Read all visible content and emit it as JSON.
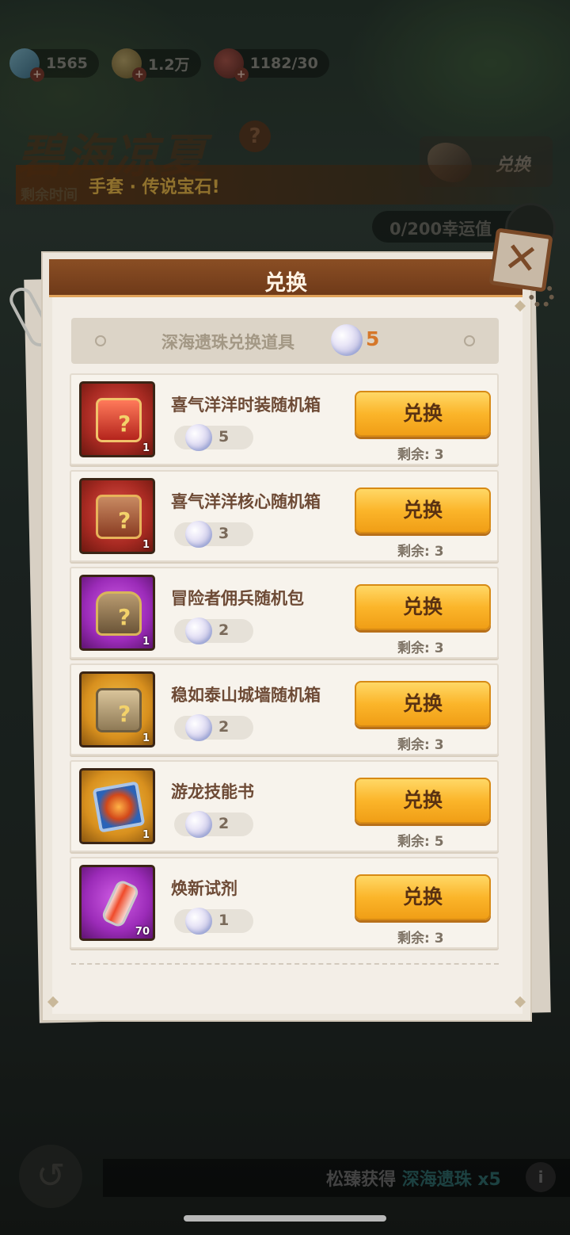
{
  "resources": [
    {
      "icon": "gem-icon",
      "value": "1565"
    },
    {
      "icon": "coin-icon",
      "value": "1.2万"
    },
    {
      "icon": "meat-icon",
      "value": "1182/30"
    }
  ],
  "event": {
    "title": "碧海凉夏",
    "time_label": "剩余时间",
    "banner": "手套 · 传说宝石!",
    "top_exchange_label": "兑换",
    "luck": "0/200幸运值"
  },
  "modal": {
    "title": "兑换",
    "close_symbol": "✕",
    "currency_label": "深海遗珠兑换道具",
    "currency_amount": "5",
    "button_label": "兑换",
    "items": [
      {
        "name": "喜气洋洋时装随机箱",
        "qty": "1",
        "cost": "5",
        "remain": "剩余: 3",
        "frame": "red",
        "art": "box-red"
      },
      {
        "name": "喜气洋洋核心随机箱",
        "qty": "1",
        "cost": "3",
        "remain": "剩余: 3",
        "frame": "red",
        "art": "box-core"
      },
      {
        "name": "冒险者佣兵随机包",
        "qty": "1",
        "cost": "2",
        "remain": "剩余: 3",
        "frame": "purple",
        "art": "pack"
      },
      {
        "name": "稳如泰山城墙随机箱",
        "qty": "1",
        "cost": "2",
        "remain": "剩余: 3",
        "frame": "gold",
        "art": "wall"
      },
      {
        "name": "游龙技能书",
        "qty": "1",
        "cost": "2",
        "remain": "剩余: 5",
        "frame": "gold",
        "art": "book"
      },
      {
        "name": "焕新试剂",
        "qty": "70",
        "cost": "1",
        "remain": "剩余: 3",
        "frame": "purple",
        "art": "vial"
      }
    ]
  },
  "footer": {
    "prefix": "松臻获得",
    "highlight": "深海遗珠 x5",
    "info_symbol": "i",
    "back_symbol": "↺"
  },
  "colors": {
    "accent": "#fbb52a",
    "header": "#7d431d",
    "cost_text": "#d5772a"
  }
}
